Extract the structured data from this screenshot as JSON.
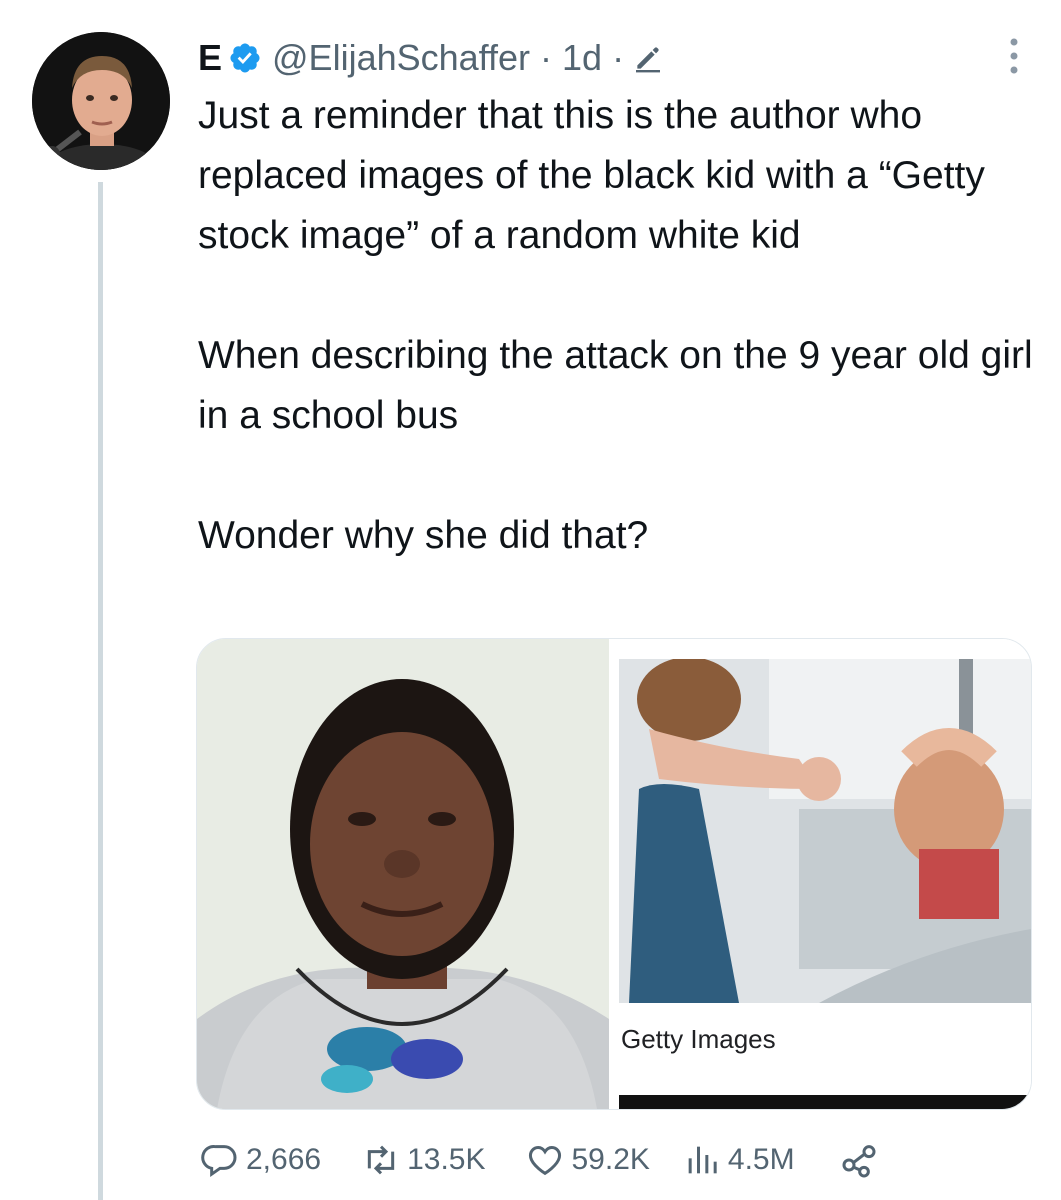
{
  "author": {
    "display_name": "E",
    "handle": "@ElijahSchaffer",
    "verified": true,
    "time_meta": "· 1d ·"
  },
  "icons": {
    "verified": "verified-badge-icon",
    "edit": "edit-pencil-icon",
    "more": "more-vertical-icon",
    "reply": "reply-bubble-icon",
    "retweet": "retweet-icon",
    "like": "heart-icon",
    "views": "views-bar-chart-icon",
    "share": "share-icon"
  },
  "tweet": {
    "paragraphs": [
      "Just a reminder that this is the author who replaced images of the black kid with a “Getty stock image” of a random white kid",
      "When describing the attack on the 9 year old girl in a school bus",
      "Wonder why she did that?"
    ]
  },
  "media": {
    "right_caption": "Getty Images"
  },
  "actions": {
    "replies": "2,666",
    "retweets": "13.5K",
    "likes": "59.2K",
    "views": "4.5M"
  },
  "colors": {
    "verified": "#1d9bf0",
    "muted": "#536471",
    "text": "#0f1419",
    "thread_line": "#cfd9de"
  }
}
